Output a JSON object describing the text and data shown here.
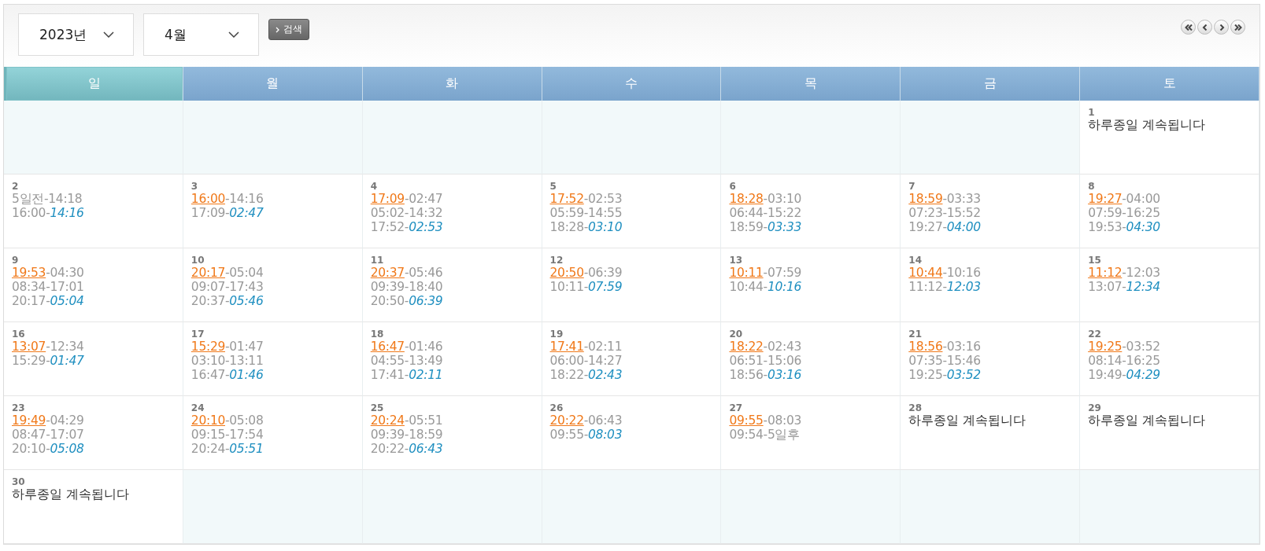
{
  "toolbar": {
    "year_select": {
      "value": "2023년"
    },
    "month_select": {
      "value": "4월"
    },
    "search_button": {
      "label": "검색"
    }
  },
  "weekdays": [
    {
      "label": "일",
      "selected": true
    },
    {
      "label": "월",
      "selected": false
    },
    {
      "label": "화",
      "selected": false
    },
    {
      "label": "수",
      "selected": false
    },
    {
      "label": "목",
      "selected": false
    },
    {
      "label": "금",
      "selected": false
    },
    {
      "label": "토",
      "selected": false
    }
  ],
  "weeks": [
    [
      {
        "kind": "empty"
      },
      {
        "kind": "empty"
      },
      {
        "kind": "empty"
      },
      {
        "kind": "empty"
      },
      {
        "kind": "empty"
      },
      {
        "kind": "empty"
      },
      {
        "kind": "day",
        "day": "1",
        "lines": [
          {
            "kind": "note",
            "text": "하루종일 계속됩니다"
          }
        ]
      }
    ],
    [
      {
        "kind": "day",
        "day": "2",
        "lines": [
          {
            "kind": "plain",
            "text": "5일전-14:18"
          },
          {
            "kind": "end",
            "text": "16:00-",
            "time": "14:16"
          }
        ]
      },
      {
        "kind": "day",
        "day": "3",
        "lines": [
          {
            "kind": "start",
            "time": "16:00",
            "text": "-14:16"
          },
          {
            "kind": "end",
            "text": "17:09-",
            "time": "02:47"
          }
        ]
      },
      {
        "kind": "day",
        "day": "4",
        "lines": [
          {
            "kind": "start",
            "time": "17:09",
            "text": "-02:47"
          },
          {
            "kind": "plain",
            "text": "05:02-14:32"
          },
          {
            "kind": "end",
            "text": "17:52-",
            "time": "02:53"
          }
        ]
      },
      {
        "kind": "day",
        "day": "5",
        "lines": [
          {
            "kind": "start",
            "time": "17:52",
            "text": "-02:53"
          },
          {
            "kind": "plain",
            "text": "05:59-14:55"
          },
          {
            "kind": "end",
            "text": "18:28-",
            "time": "03:10"
          }
        ]
      },
      {
        "kind": "day",
        "day": "6",
        "lines": [
          {
            "kind": "start",
            "time": "18:28",
            "text": "-03:10"
          },
          {
            "kind": "plain",
            "text": "06:44-15:22"
          },
          {
            "kind": "end",
            "text": "18:59-",
            "time": "03:33"
          }
        ]
      },
      {
        "kind": "day",
        "day": "7",
        "lines": [
          {
            "kind": "start",
            "time": "18:59",
            "text": "-03:33"
          },
          {
            "kind": "plain",
            "text": "07:23-15:52"
          },
          {
            "kind": "end",
            "text": "19:27-",
            "time": "04:00"
          }
        ]
      },
      {
        "kind": "day",
        "day": "8",
        "lines": [
          {
            "kind": "start",
            "time": "19:27",
            "text": "-04:00"
          },
          {
            "kind": "plain",
            "text": "07:59-16:25"
          },
          {
            "kind": "end",
            "text": "19:53-",
            "time": "04:30"
          }
        ]
      }
    ],
    [
      {
        "kind": "day",
        "day": "9",
        "lines": [
          {
            "kind": "start",
            "time": "19:53",
            "text": "-04:30"
          },
          {
            "kind": "plain",
            "text": "08:34-17:01"
          },
          {
            "kind": "end",
            "text": "20:17-",
            "time": "05:04"
          }
        ]
      },
      {
        "kind": "day",
        "day": "10",
        "lines": [
          {
            "kind": "start",
            "time": "20:17",
            "text": "-05:04"
          },
          {
            "kind": "plain",
            "text": "09:07-17:43"
          },
          {
            "kind": "end",
            "text": "20:37-",
            "time": "05:46"
          }
        ]
      },
      {
        "kind": "day",
        "day": "11",
        "lines": [
          {
            "kind": "start",
            "time": "20:37",
            "text": "-05:46"
          },
          {
            "kind": "plain",
            "text": "09:39-18:40"
          },
          {
            "kind": "end",
            "text": "20:50-",
            "time": "06:39"
          }
        ]
      },
      {
        "kind": "day",
        "day": "12",
        "lines": [
          {
            "kind": "start",
            "time": "20:50",
            "text": "-06:39"
          },
          {
            "kind": "end",
            "text": "10:11-",
            "time": "07:59"
          }
        ]
      },
      {
        "kind": "day",
        "day": "13",
        "lines": [
          {
            "kind": "start",
            "time": "10:11",
            "text": "-07:59"
          },
          {
            "kind": "end",
            "text": "10:44-",
            "time": "10:16"
          }
        ]
      },
      {
        "kind": "day",
        "day": "14",
        "lines": [
          {
            "kind": "start",
            "time": "10:44",
            "text": "-10:16"
          },
          {
            "kind": "end",
            "text": "11:12-",
            "time": "12:03"
          }
        ]
      },
      {
        "kind": "day",
        "day": "15",
        "lines": [
          {
            "kind": "start",
            "time": "11:12",
            "text": "-12:03"
          },
          {
            "kind": "end",
            "text": "13:07-",
            "time": "12:34"
          }
        ]
      }
    ],
    [
      {
        "kind": "day",
        "day": "16",
        "lines": [
          {
            "kind": "start",
            "time": "13:07",
            "text": "-12:34"
          },
          {
            "kind": "end",
            "text": "15:29-",
            "time": "01:47"
          }
        ]
      },
      {
        "kind": "day",
        "day": "17",
        "lines": [
          {
            "kind": "start",
            "time": "15:29",
            "text": "-01:47"
          },
          {
            "kind": "plain",
            "text": "03:10-13:11"
          },
          {
            "kind": "end",
            "text": "16:47-",
            "time": "01:46"
          }
        ]
      },
      {
        "kind": "day",
        "day": "18",
        "lines": [
          {
            "kind": "start",
            "time": "16:47",
            "text": "-01:46"
          },
          {
            "kind": "plain",
            "text": "04:55-13:49"
          },
          {
            "kind": "end",
            "text": "17:41-",
            "time": "02:11"
          }
        ]
      },
      {
        "kind": "day",
        "day": "19",
        "lines": [
          {
            "kind": "start",
            "time": "17:41",
            "text": "-02:11"
          },
          {
            "kind": "plain",
            "text": "06:00-14:27"
          },
          {
            "kind": "end",
            "text": "18:22-",
            "time": "02:43"
          }
        ]
      },
      {
        "kind": "day",
        "day": "20",
        "lines": [
          {
            "kind": "start",
            "time": "18:22",
            "text": "-02:43"
          },
          {
            "kind": "plain",
            "text": "06:51-15:06"
          },
          {
            "kind": "end",
            "text": "18:56-",
            "time": "03:16"
          }
        ]
      },
      {
        "kind": "day",
        "day": "21",
        "lines": [
          {
            "kind": "start",
            "time": "18:56",
            "text": "-03:16"
          },
          {
            "kind": "plain",
            "text": "07:35-15:46"
          },
          {
            "kind": "end",
            "text": "19:25-",
            "time": "03:52"
          }
        ]
      },
      {
        "kind": "day",
        "day": "22",
        "lines": [
          {
            "kind": "start",
            "time": "19:25",
            "text": "-03:52"
          },
          {
            "kind": "plain",
            "text": "08:14-16:25"
          },
          {
            "kind": "end",
            "text": "19:49-",
            "time": "04:29"
          }
        ]
      }
    ],
    [
      {
        "kind": "day",
        "day": "23",
        "lines": [
          {
            "kind": "start",
            "time": "19:49",
            "text": "-04:29"
          },
          {
            "kind": "plain",
            "text": "08:47-17:07"
          },
          {
            "kind": "end",
            "text": "20:10-",
            "time": "05:08"
          }
        ]
      },
      {
        "kind": "day",
        "day": "24",
        "lines": [
          {
            "kind": "start",
            "time": "20:10",
            "text": "-05:08"
          },
          {
            "kind": "plain",
            "text": "09:15-17:54"
          },
          {
            "kind": "end",
            "text": "20:24-",
            "time": "05:51"
          }
        ]
      },
      {
        "kind": "day",
        "day": "25",
        "lines": [
          {
            "kind": "start",
            "time": "20:24",
            "text": "-05:51"
          },
          {
            "kind": "plain",
            "text": "09:39-18:59"
          },
          {
            "kind": "end",
            "text": "20:22-",
            "time": "06:43"
          }
        ]
      },
      {
        "kind": "day",
        "day": "26",
        "lines": [
          {
            "kind": "start",
            "time": "20:22",
            "text": "-06:43"
          },
          {
            "kind": "end",
            "text": "09:55-",
            "time": "08:03"
          }
        ]
      },
      {
        "kind": "day",
        "day": "27",
        "lines": [
          {
            "kind": "start",
            "time": "09:55",
            "text": "-08:03"
          },
          {
            "kind": "plain",
            "text": "09:54-5일후"
          }
        ]
      },
      {
        "kind": "day",
        "day": "28",
        "lines": [
          {
            "kind": "note",
            "text": "하루종일 계속됩니다"
          }
        ]
      },
      {
        "kind": "day",
        "day": "29",
        "lines": [
          {
            "kind": "note",
            "text": "하루종일 계속됩니다"
          }
        ]
      }
    ],
    [
      {
        "kind": "day",
        "day": "30",
        "lines": [
          {
            "kind": "note",
            "text": "하루종일 계속됩니다"
          }
        ]
      },
      {
        "kind": "empty"
      },
      {
        "kind": "empty"
      },
      {
        "kind": "empty"
      },
      {
        "kind": "empty"
      },
      {
        "kind": "empty"
      },
      {
        "kind": "empty"
      }
    ]
  ]
}
